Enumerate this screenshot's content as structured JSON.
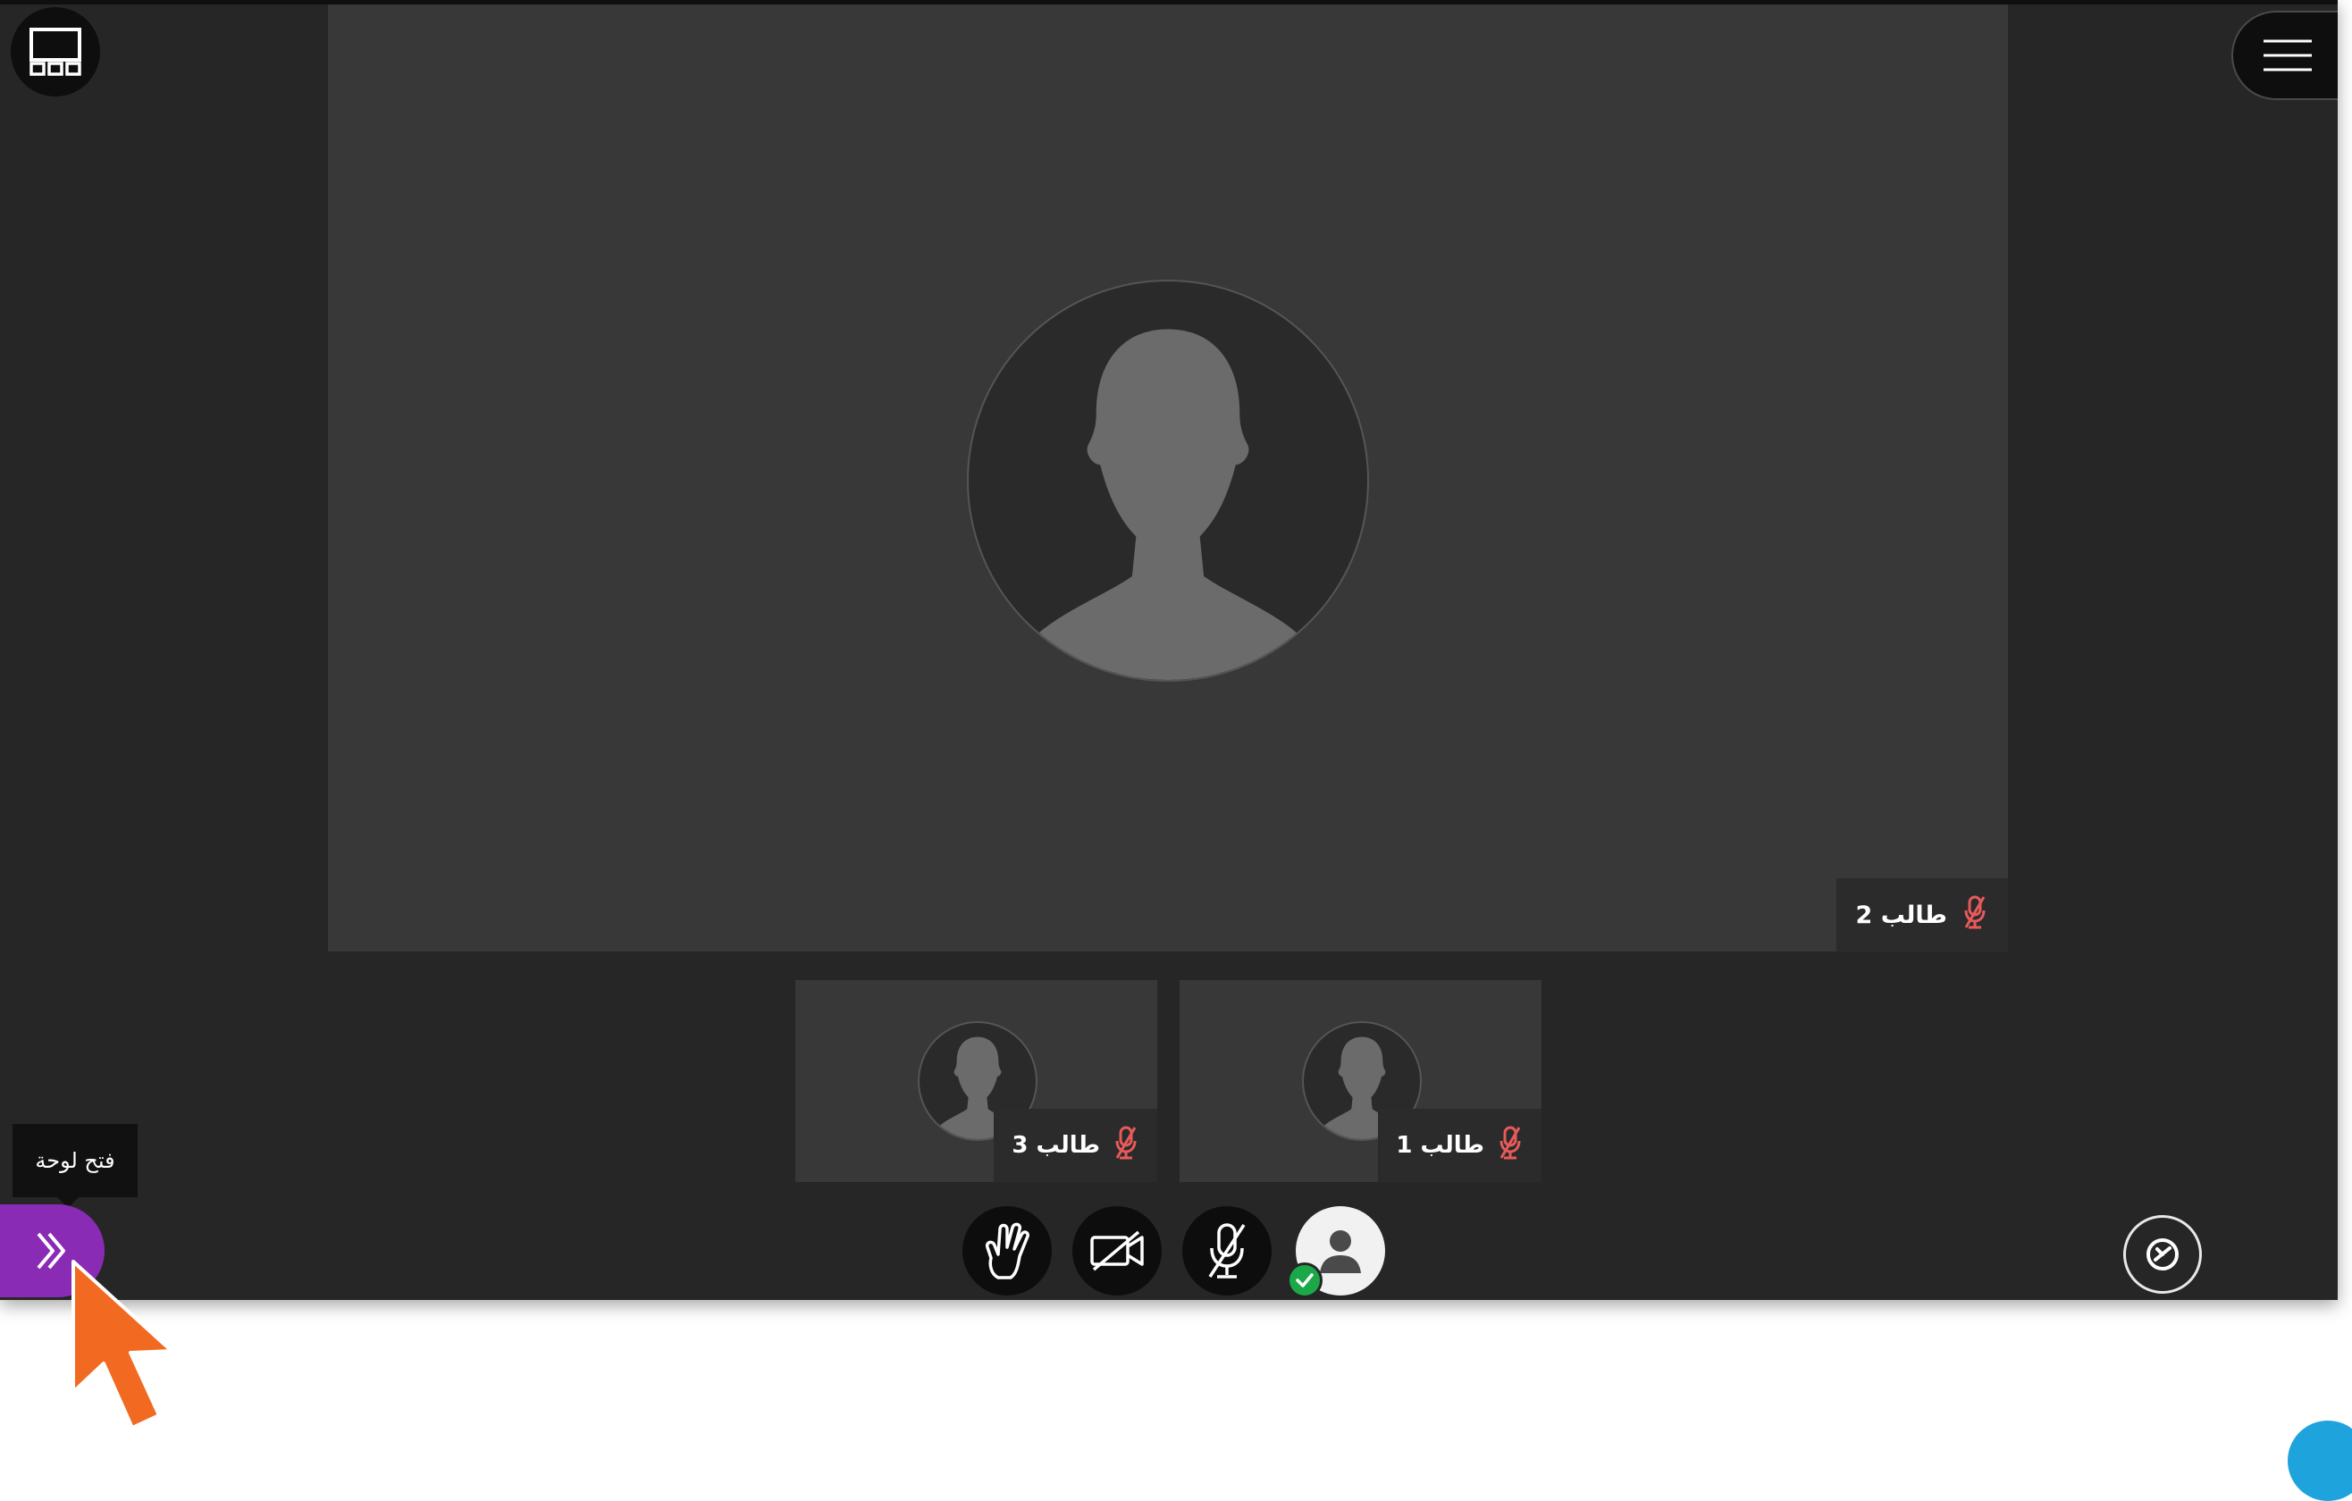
{
  "stage": {
    "main_participant": "طالب 2"
  },
  "thumbnails": [
    {
      "name": "طالب 3"
    },
    {
      "name": "طالب 1"
    }
  ],
  "controls": {
    "raise_hand_icon": "raise-hand-icon",
    "camera_icon": "camera-off-icon",
    "mic_icon": "mic-off-icon",
    "profile_icon": "profile-icon"
  },
  "panel": {
    "tooltip": "فتح لوحة",
    "open_icon": "double-chevron-right-icon"
  },
  "colors": {
    "background": "#262626",
    "stage": "#383838",
    "muted_mic": "#e85a5a",
    "panel_button": "#8a2bb5",
    "status_ok": "#1ba848",
    "cursor": "#f26a21"
  }
}
